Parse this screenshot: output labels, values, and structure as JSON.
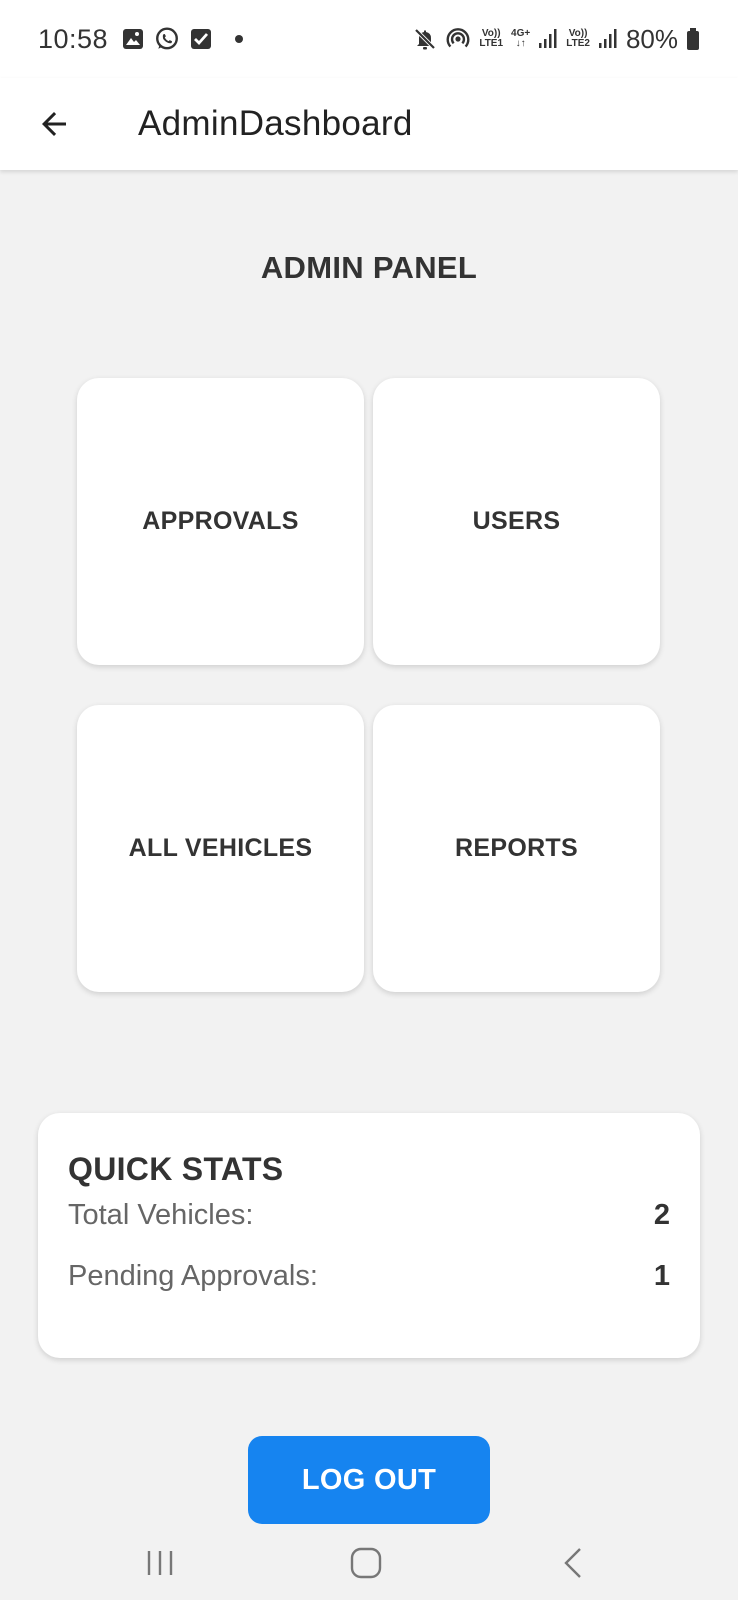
{
  "status_bar": {
    "time": "10:58",
    "net1_top": "Vo))",
    "net1_bottom": "LTE1",
    "net_type": "4G+",
    "net_arrows": "↓↑",
    "net2_top": "Vo))",
    "net2_bottom": "LTE2",
    "battery": "80%",
    "icons": [
      "gallery-icon",
      "whatsapp-icon",
      "checkbox-icon",
      "dot-icon",
      "mute-icon",
      "hotspot-icon",
      "signal-icon",
      "battery-icon"
    ]
  },
  "app_bar": {
    "back_icon": "arrow-left-icon",
    "title": "AdminDashboard"
  },
  "panel": {
    "title": "ADMIN PANEL",
    "tiles": [
      {
        "label": "APPROVALS"
      },
      {
        "label": "USERS"
      },
      {
        "label": "ALL VEHICLES"
      },
      {
        "label": "REPORTS"
      }
    ]
  },
  "stats": {
    "title": "QUICK STATS",
    "rows": [
      {
        "label": "Total Vehicles:",
        "value": "2"
      },
      {
        "label": "Pending Approvals:",
        "value": "1"
      }
    ]
  },
  "logout": {
    "label": "LOG OUT",
    "color": "#1684f0"
  },
  "nav": {
    "icons": [
      "recents-icon",
      "home-icon",
      "back-icon"
    ]
  }
}
